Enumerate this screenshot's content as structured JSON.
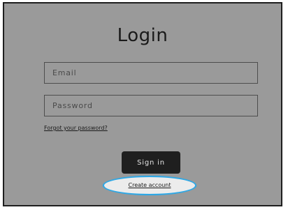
{
  "login": {
    "title": "Login",
    "email_placeholder": "Email",
    "password_placeholder": "Password",
    "forgot_password_label": "Forgot your password?",
    "sign_in_label": "Sign in",
    "create_account_label": "Create account"
  },
  "colors": {
    "panel_background": "#9a9a9a",
    "button_background": "#1f1f1f",
    "highlight_ring": "#2ea8e6"
  }
}
